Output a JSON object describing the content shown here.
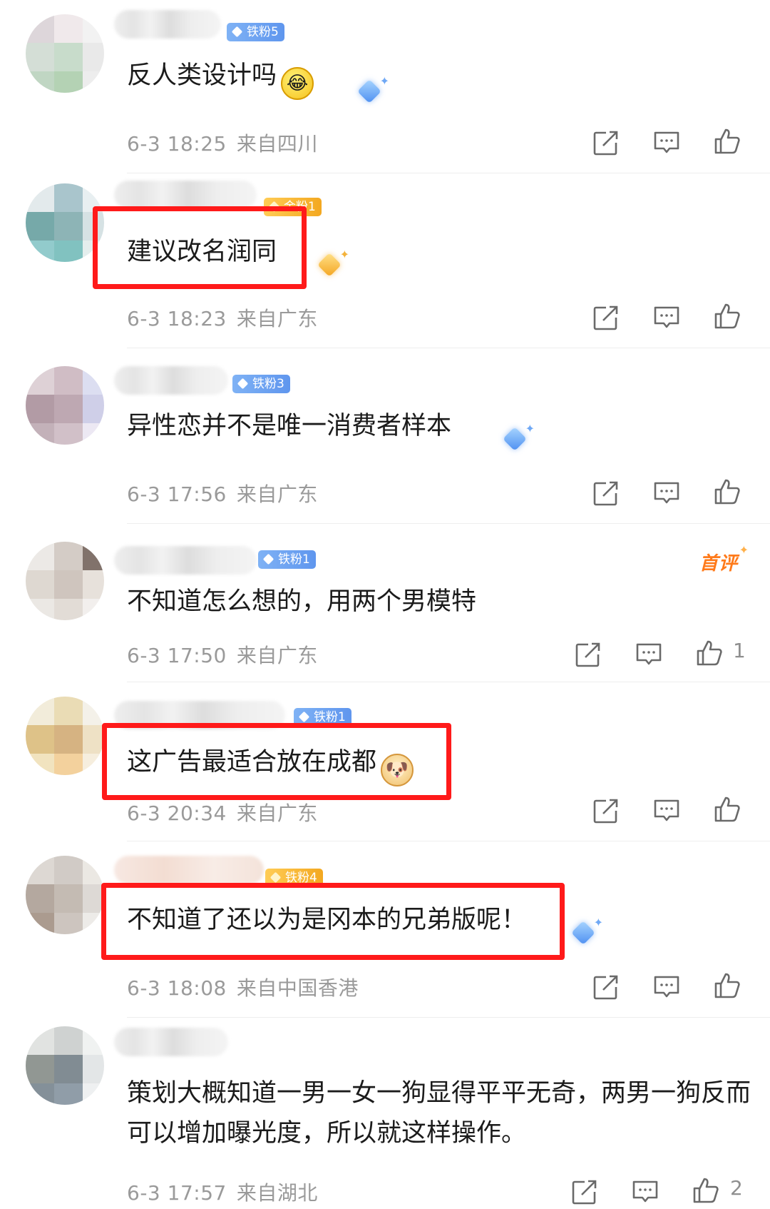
{
  "comments": [
    {
      "badge": "铁粉5",
      "text": "反人类设计吗",
      "emoji": "laugh-cry-emoji",
      "time": "6-3 18:25",
      "location": "来自四川",
      "likes": ""
    },
    {
      "badge": "金粉1",
      "text": "建议改名润同",
      "emoji": "",
      "time": "6-3 18:23",
      "location": "来自广东",
      "likes": ""
    },
    {
      "badge": "铁粉3",
      "text": "异性恋并不是唯一消费者样本",
      "emoji": "",
      "time": "6-3 17:56",
      "location": "来自广东",
      "likes": ""
    },
    {
      "badge": "铁粉1",
      "tag": "首评",
      "text": "不知道怎么想的，用两个男模特",
      "emoji": "",
      "time": "6-3 17:50",
      "location": "来自广东",
      "likes": "1"
    },
    {
      "badge": "铁粉1",
      "text": "这广告最适合放在成都",
      "emoji": "doge-emoji",
      "time": "6-3 20:34",
      "location": "来自广东",
      "likes": ""
    },
    {
      "badge": "铁粉4",
      "text": "不知道了还以为是冈本的兄弟版呢！",
      "emoji": "",
      "time": "6-3 18:08",
      "location": "来自中国香港",
      "likes": ""
    },
    {
      "badge": "",
      "text": "策划大概知道一男一女一狗显得平平无奇，两男一狗反而可以增加曝光度，所以就这样操作。",
      "emoji": "",
      "time": "6-3 17:57",
      "location": "来自湖北",
      "likes": "2"
    }
  ],
  "icons": {
    "share": "share-icon",
    "reply": "comment-icon",
    "like": "thumbs-up-icon"
  },
  "colors": {
    "text": "#1b1b1b",
    "meta": "#9a9a9a",
    "badge_blue": "#6fa3f2",
    "badge_gold": "#f3a820",
    "highlight": "#ff1a1a",
    "first_comment": "#ff7a1a"
  }
}
